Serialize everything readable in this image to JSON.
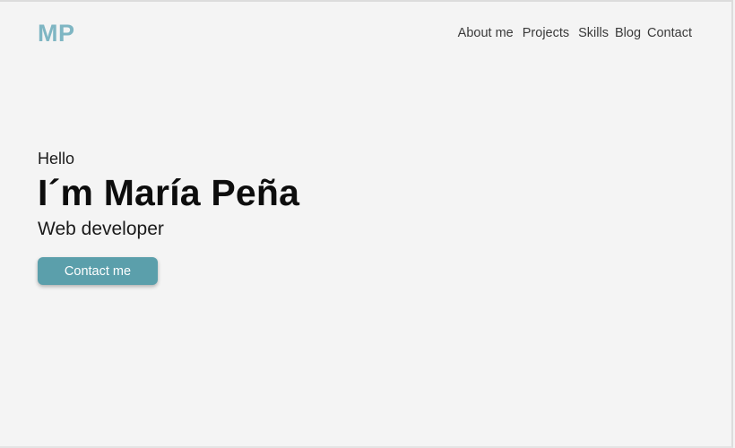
{
  "header": {
    "logo": "MP",
    "nav": [
      {
        "label": "About me"
      },
      {
        "label": "Projects"
      },
      {
        "label": "Skills"
      },
      {
        "label": "Blog"
      },
      {
        "label": "Contact"
      }
    ]
  },
  "hero": {
    "greeting": "Hello",
    "name": "I´m María Peña",
    "role": "Web developer",
    "cta_label": "Contact me"
  },
  "colors": {
    "background": "#f4f4f4",
    "logo": "#7fb6c3",
    "button": "#5b9fab",
    "text": "#111111"
  }
}
